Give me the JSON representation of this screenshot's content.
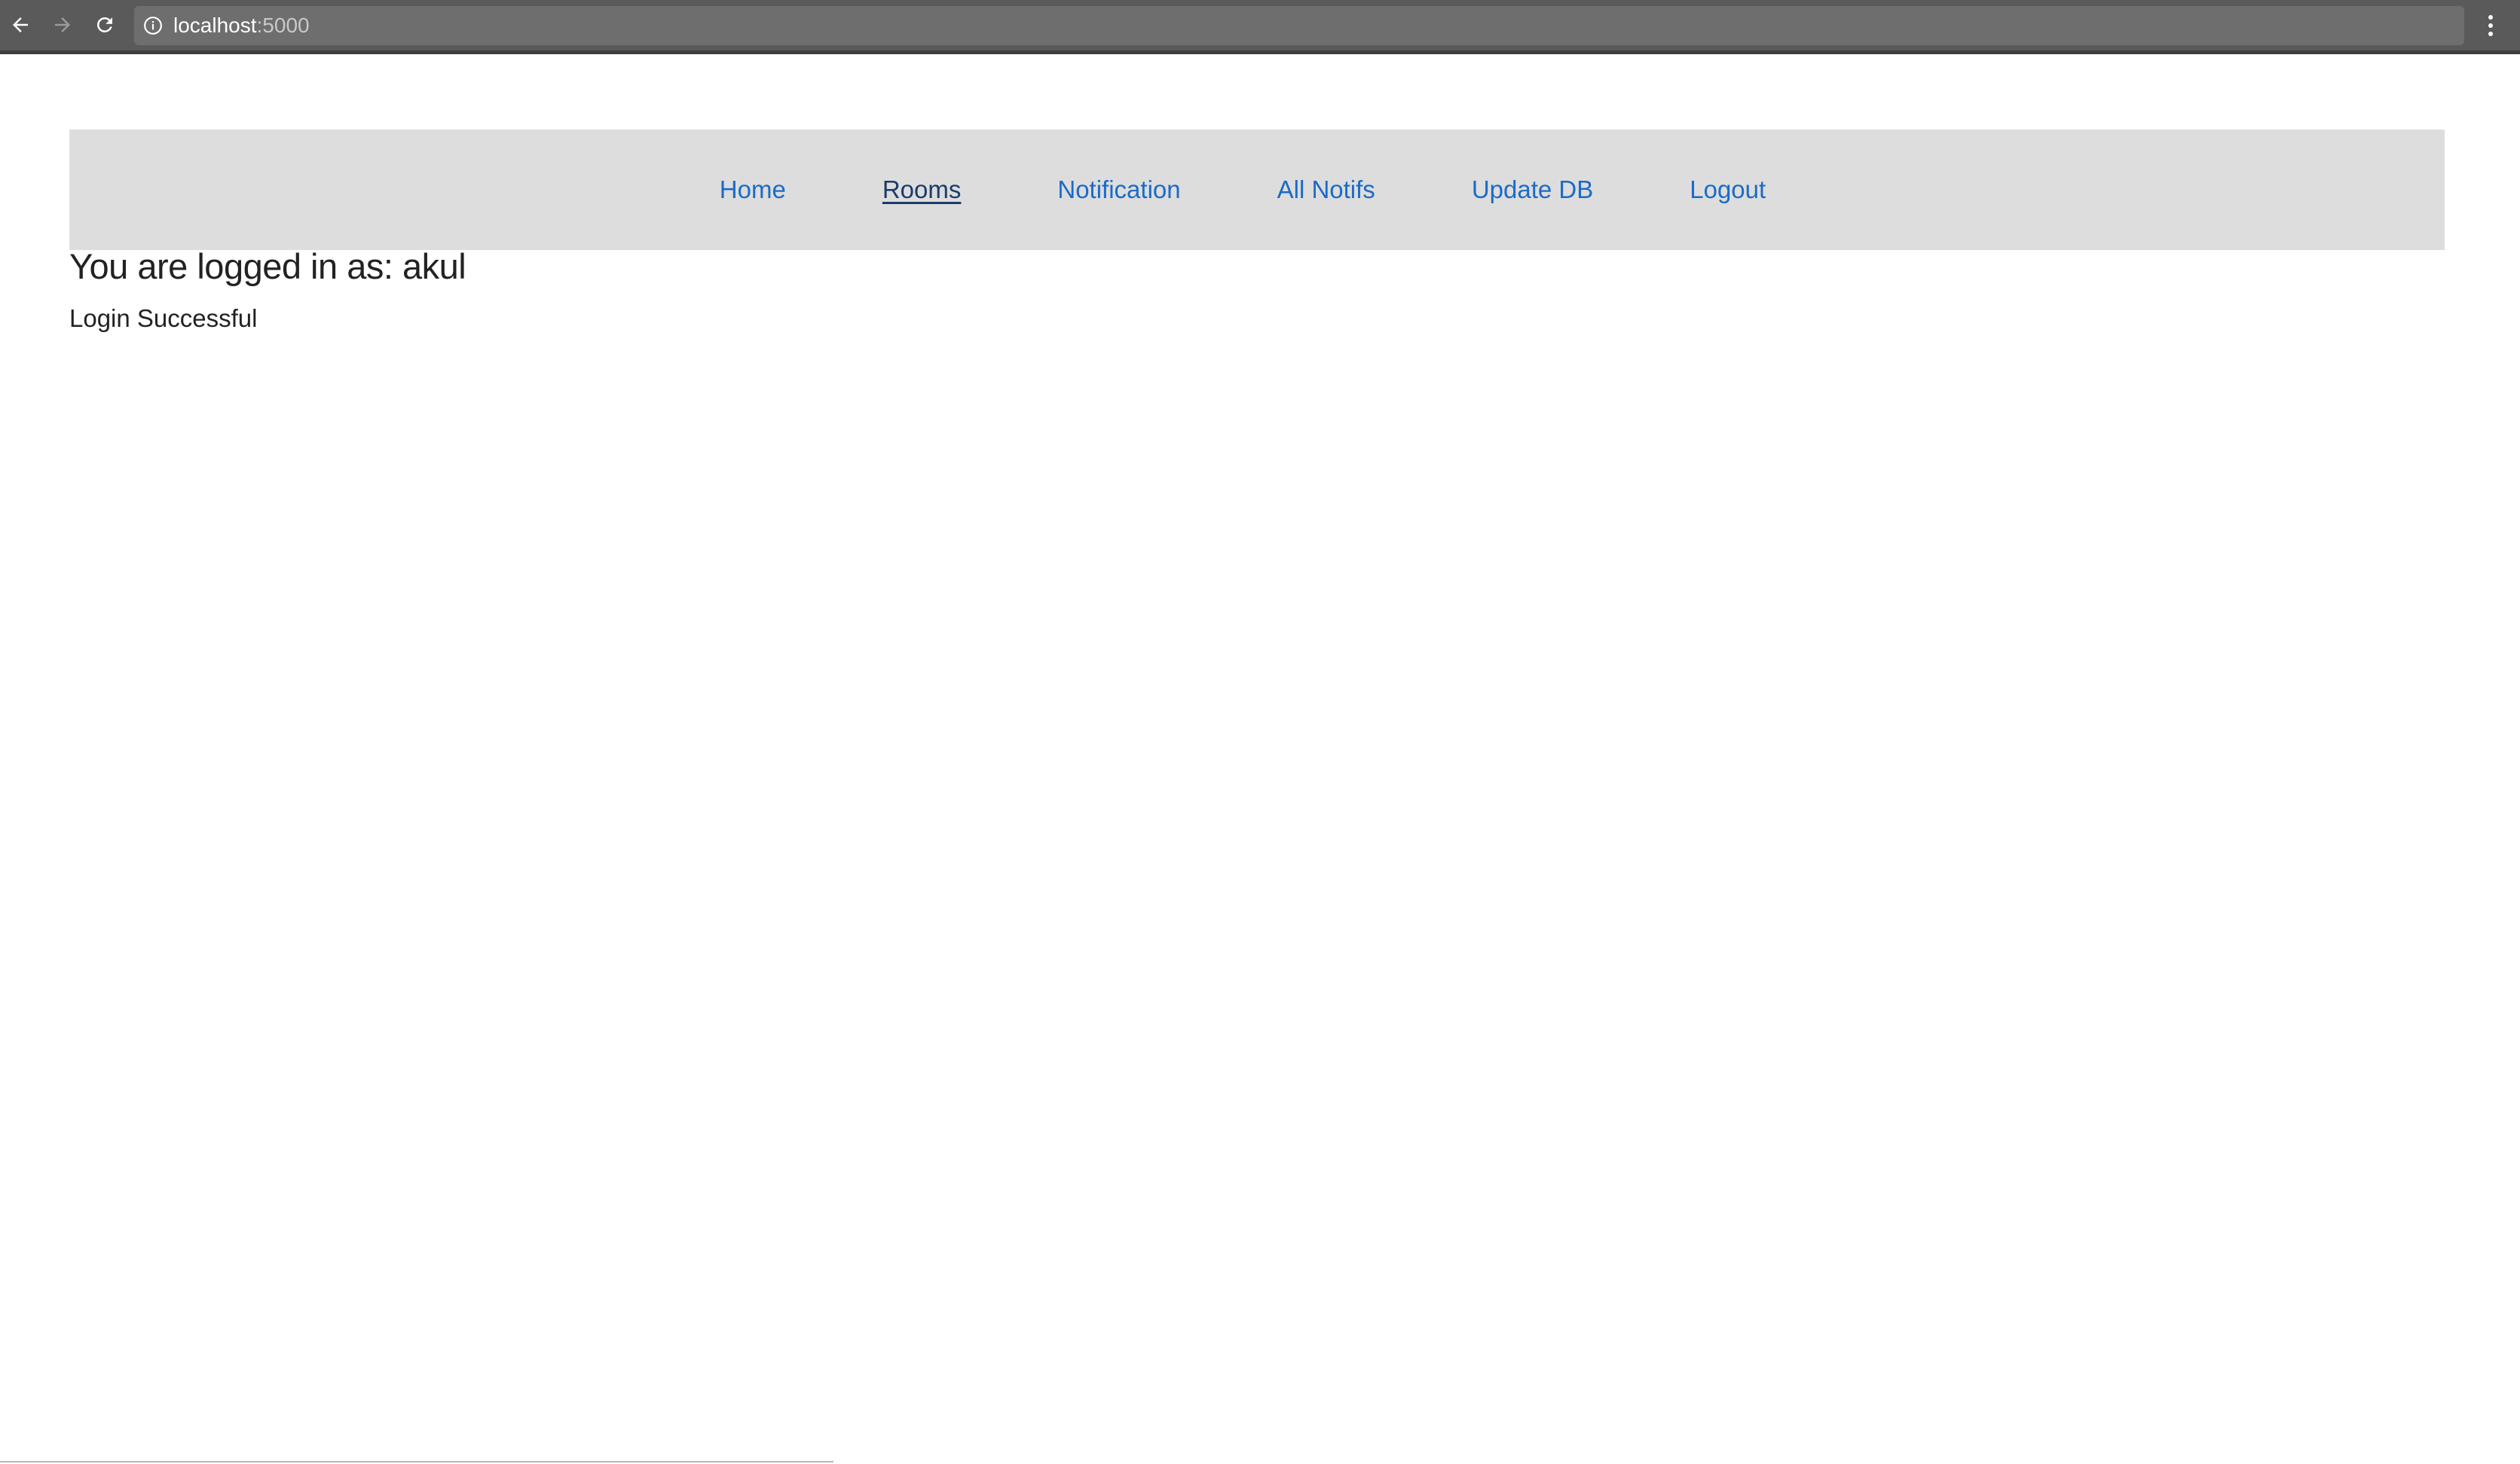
{
  "browser": {
    "url_host": "localhost",
    "url_port": ":5000",
    "back_icon": "arrow-left-icon",
    "forward_icon": "arrow-right-icon",
    "reload_icon": "reload-icon",
    "info_icon": "info-icon",
    "menu_icon": "vertical-dots-icon"
  },
  "nav": {
    "items": [
      {
        "label": "Home",
        "active": false
      },
      {
        "label": "Rooms",
        "active": true
      },
      {
        "label": "Notification",
        "active": false
      },
      {
        "label": "All Notifs",
        "active": false
      },
      {
        "label": "Update DB",
        "active": false
      },
      {
        "label": "Logout",
        "active": false
      }
    ]
  },
  "main": {
    "heading": "You are logged in as: akul",
    "status": "Login Successful"
  },
  "colors": {
    "link": "#1a6bc8",
    "active_link": "#1c3b6a",
    "navbar_bg": "#dddddd",
    "browser_bar": "#5a5a5a"
  }
}
